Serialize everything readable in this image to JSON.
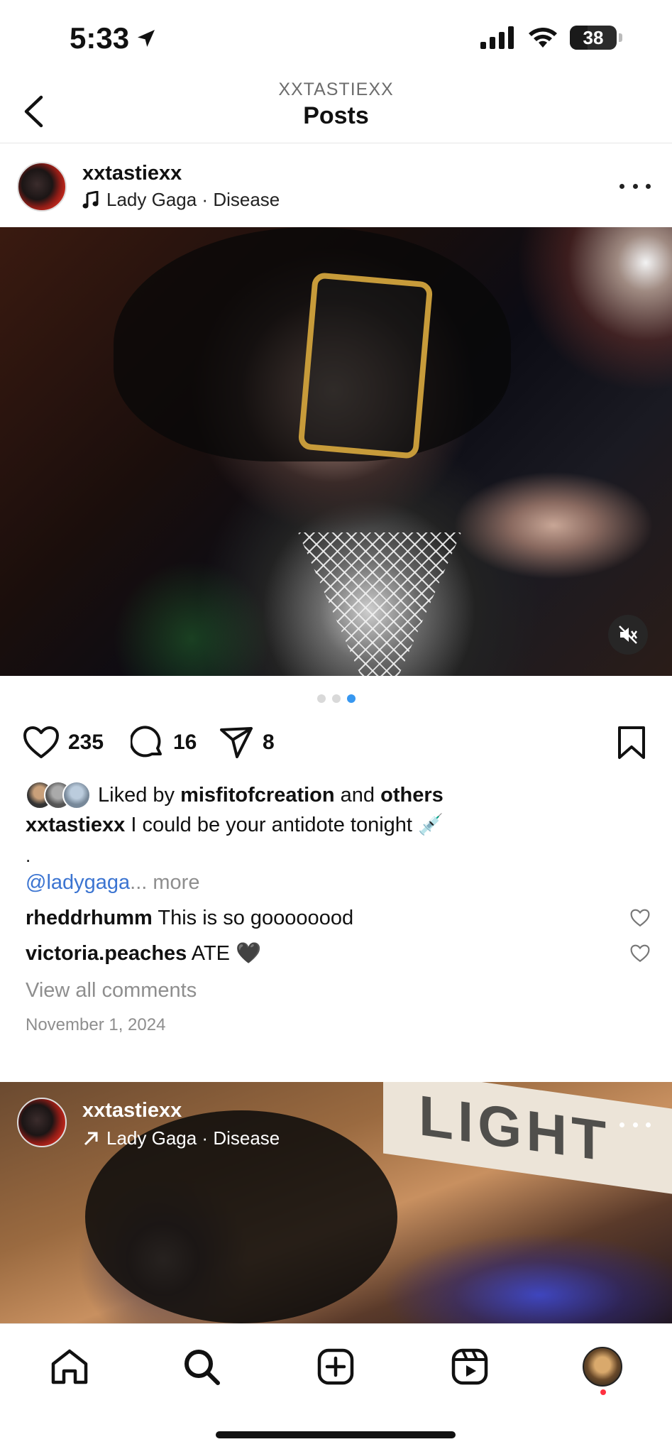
{
  "status_bar": {
    "time": "5:33",
    "battery": "38",
    "battery_level": 0.38
  },
  "header": {
    "account": "XXTASTIEXX",
    "title": "Posts"
  },
  "post1": {
    "username": "xxtastiexx",
    "audio": "Lady Gaga · Disease",
    "media_slides": 3,
    "active_slide": 3,
    "likes": "235",
    "comments": "16",
    "shares": "8",
    "liked_by_prefix": "Liked by",
    "liked_by_user": "misfitofcreation",
    "liked_by_and": "and",
    "liked_by_others": "others",
    "caption_user": "xxtastiexx",
    "caption_text": "I could be your antidote tonight 💉",
    "caption_dot": ".",
    "mention": "@ladygaga",
    "more_label": "... more",
    "comments_list": [
      {
        "user": "rheddrhumm",
        "text": "This is so goooooood"
      },
      {
        "user": "victoria.peaches",
        "text": "ATE 🖤"
      }
    ],
    "view_all": "View all comments",
    "date": "November 1, 2024"
  },
  "post2": {
    "username": "xxtastiexx",
    "audio": "Lady Gaga · Disease",
    "sign_text": "LIGHT"
  },
  "colors": {
    "link": "#3b74d1",
    "active_dot": "#3797f0",
    "muted": "#8e8e8e",
    "notification": "#ff3040"
  },
  "icons": {
    "location": "location-arrow-icon",
    "signal": "cellular-signal-icon",
    "wifi": "wifi-icon",
    "back": "chevron-left-icon",
    "music": "music-note-icon",
    "more": "more-horizontal-icon",
    "mute": "speaker-muted-icon",
    "like": "heart-icon",
    "comment": "comment-bubble-icon",
    "share": "paper-plane-icon",
    "save": "bookmark-icon",
    "home": "home-icon",
    "search": "search-icon",
    "create": "plus-square-icon",
    "reels": "reels-icon"
  }
}
